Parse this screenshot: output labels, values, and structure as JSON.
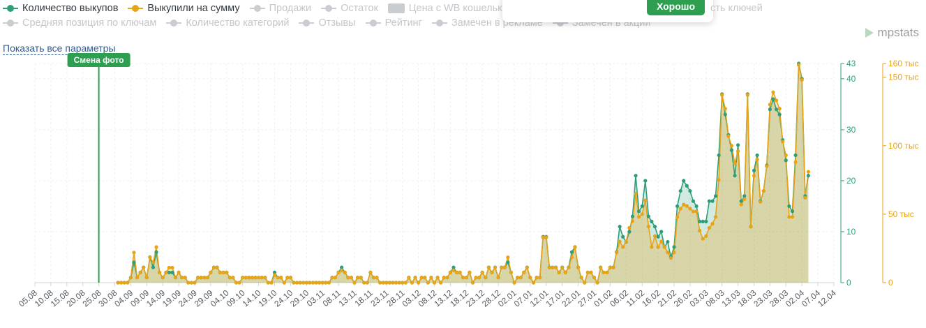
{
  "legend": {
    "row1": [
      {
        "label": "Количество выкупов",
        "active": true,
        "color": "#2e9e7a",
        "kind": "line"
      },
      {
        "label": "Выкупили на сумму",
        "active": true,
        "color": "#e8a317",
        "kind": "line"
      },
      {
        "label": "Продажи",
        "active": false,
        "kind": "line"
      },
      {
        "label": "Остаток",
        "active": false,
        "kind": "line"
      },
      {
        "label": "Цена с WB кошельком",
        "active": false,
        "kind": "swatch"
      }
    ],
    "row1_tail": "сть ключей",
    "row2": [
      {
        "label": "Средняя позиция по ключам",
        "active": false,
        "kind": "line"
      },
      {
        "label": "Количество категорий",
        "active": false,
        "kind": "line"
      },
      {
        "label": "Отзывы",
        "active": false,
        "kind": "line"
      },
      {
        "label": "Рейтинг",
        "active": false,
        "kind": "line"
      },
      {
        "label": "Замечен в рекламе",
        "active": false,
        "kind": "line"
      },
      {
        "label": "Замечен в акции",
        "active": false,
        "kind": "line"
      }
    ]
  },
  "popup": {
    "ok_label": "Хорошо"
  },
  "show_all_label": "Показать все параметры",
  "brand": "mpstats",
  "chart_data": {
    "type": "line",
    "x_tick_labels": [
      "05.08",
      "10.08",
      "15.08",
      "20.08",
      "25.08",
      "30.08",
      "04.09",
      "09.09",
      "14.09",
      "19.09",
      "24.09",
      "29.09",
      "04.10",
      "09.10",
      "14.10",
      "19.10",
      "24.10",
      "29.10",
      "03.11",
      "08.11",
      "13.11",
      "18.11",
      "23.11",
      "28.11",
      "03.12",
      "08.12",
      "13.12",
      "18.12",
      "23.12",
      "28.12",
      "02.01",
      "07.01",
      "12.01",
      "17.01",
      "22.01",
      "27.01",
      "01.02",
      "06.02",
      "11.02",
      "16.02",
      "21.02",
      "26.02",
      "03.03",
      "08.03",
      "13.03",
      "18.03",
      "23.03",
      "28.03",
      "02.04",
      "07.04",
      "12.04"
    ],
    "data_start_index": 26,
    "left_axis": {
      "ticks": [
        0,
        10,
        20,
        30,
        40,
        43
      ],
      "max": 43,
      "color": "#2e9e7a"
    },
    "right_axis": {
      "ticks": [
        {
          "value": 0,
          "label": "0"
        },
        {
          "value": 50000,
          "label": "50 тыс"
        },
        {
          "value": 100000,
          "label": "100 тыс"
        },
        {
          "value": 150000,
          "label": "150 тыс"
        },
        {
          "value": 160000,
          "label": "160 тыс"
        }
      ],
      "max": 160000,
      "color": "#e8a317"
    },
    "annotation": {
      "label": "Смена фото",
      "x_index": 20,
      "color": "#2e9e51"
    },
    "series": [
      {
        "name": "Количество выкупов",
        "color": "#2e9e7a",
        "axis": "left",
        "values": [
          0,
          0,
          0,
          0,
          1,
          4,
          1,
          2,
          3,
          1,
          5,
          3,
          6,
          2,
          1,
          2,
          2,
          2,
          1,
          2,
          1,
          1,
          0,
          0,
          0,
          1,
          1,
          1,
          1,
          2,
          3,
          3,
          2,
          2,
          2,
          1,
          1,
          0,
          0,
          1,
          1,
          1,
          1,
          1,
          1,
          1,
          1,
          0,
          0,
          2,
          1,
          1,
          0,
          1,
          1,
          0,
          0,
          0,
          0,
          0,
          0,
          0,
          0,
          0,
          0,
          0,
          0,
          1,
          1,
          2,
          3,
          2,
          1,
          1,
          0,
          1,
          1,
          0,
          0,
          2,
          1,
          1,
          0,
          0,
          0,
          0,
          0,
          0,
          0,
          0,
          0,
          1,
          0,
          1,
          0,
          1,
          1,
          0,
          1,
          0,
          1,
          0,
          1,
          1,
          2,
          3,
          2,
          2,
          1,
          1,
          2,
          0,
          1,
          1,
          2,
          1,
          3,
          2,
          3,
          1,
          3,
          3,
          4,
          2,
          0,
          1,
          1,
          2,
          3,
          1,
          0,
          1,
          1,
          9,
          9,
          3,
          3,
          3,
          2,
          3,
          2,
          3,
          6,
          7,
          3,
          1,
          0,
          2,
          2,
          1,
          0,
          3,
          2,
          2,
          3,
          3,
          6,
          11,
          9,
          8,
          10,
          13,
          21,
          14,
          15,
          20,
          13,
          12,
          11,
          9,
          10,
          7,
          8,
          5,
          7,
          15,
          18,
          20,
          19,
          18,
          16,
          15,
          12,
          12,
          12,
          16,
          16,
          17,
          25,
          37,
          33,
          29,
          26,
          21,
          27,
          16,
          17,
          37,
          11,
          22,
          25,
          16,
          18,
          23,
          34,
          36,
          34,
          33,
          28,
          24,
          15,
          14,
          25,
          43,
          40,
          17,
          21
        ]
      },
      {
        "name": "Выкупили на сумму",
        "color": "#e8a317",
        "axis": "right",
        "values": [
          0,
          0,
          0,
          0,
          3700,
          22000,
          3700,
          7400,
          11000,
          3700,
          18500,
          14800,
          26000,
          7400,
          3700,
          7400,
          11000,
          11000,
          3700,
          7400,
          3700,
          3700,
          0,
          0,
          0,
          3700,
          3700,
          3700,
          3700,
          7400,
          11000,
          11000,
          7400,
          7400,
          7400,
          3700,
          3700,
          0,
          0,
          3700,
          3700,
          3700,
          3700,
          3700,
          3700,
          3700,
          3700,
          0,
          0,
          5500,
          3700,
          3700,
          0,
          3700,
          3700,
          0,
          0,
          0,
          0,
          0,
          0,
          0,
          0,
          0,
          0,
          0,
          0,
          3700,
          3700,
          7400,
          9000,
          7400,
          3700,
          3700,
          0,
          3700,
          3700,
          0,
          0,
          7400,
          3700,
          3700,
          0,
          0,
          0,
          0,
          0,
          0,
          0,
          0,
          0,
          3700,
          0,
          3700,
          0,
          3700,
          3700,
          0,
          3700,
          0,
          3700,
          0,
          3700,
          3700,
          7400,
          9000,
          7400,
          7400,
          3700,
          3700,
          7400,
          0,
          3700,
          3700,
          7400,
          3700,
          11000,
          7400,
          11000,
          3700,
          11000,
          11000,
          18500,
          7400,
          0,
          3700,
          3700,
          7400,
          11000,
          3700,
          0,
          3700,
          3700,
          33000,
          33000,
          11000,
          11000,
          11000,
          7400,
          11000,
          7400,
          11000,
          18500,
          26000,
          11000,
          3700,
          0,
          7400,
          7400,
          3700,
          0,
          11000,
          7400,
          7400,
          11000,
          11000,
          22000,
          30000,
          26000,
          30000,
          40000,
          45000,
          65000,
          48000,
          50000,
          60000,
          41000,
          26000,
          34000,
          26000,
          30000,
          26000,
          22000,
          18000,
          22000,
          48000,
          54000,
          57000,
          56000,
          54000,
          52000,
          52000,
          38000,
          32000,
          34000,
          40000,
          43000,
          48000,
          75000,
          137000,
          127000,
          107000,
          100000,
          87000,
          96000,
          57000,
          61000,
          137000,
          41000,
          78000,
          90000,
          59000,
          67000,
          85000,
          130000,
          139000,
          133000,
          127000,
          103000,
          93000,
          48000,
          48000,
          88000,
          159000,
          148000,
          62000,
          81000
        ]
      }
    ]
  }
}
